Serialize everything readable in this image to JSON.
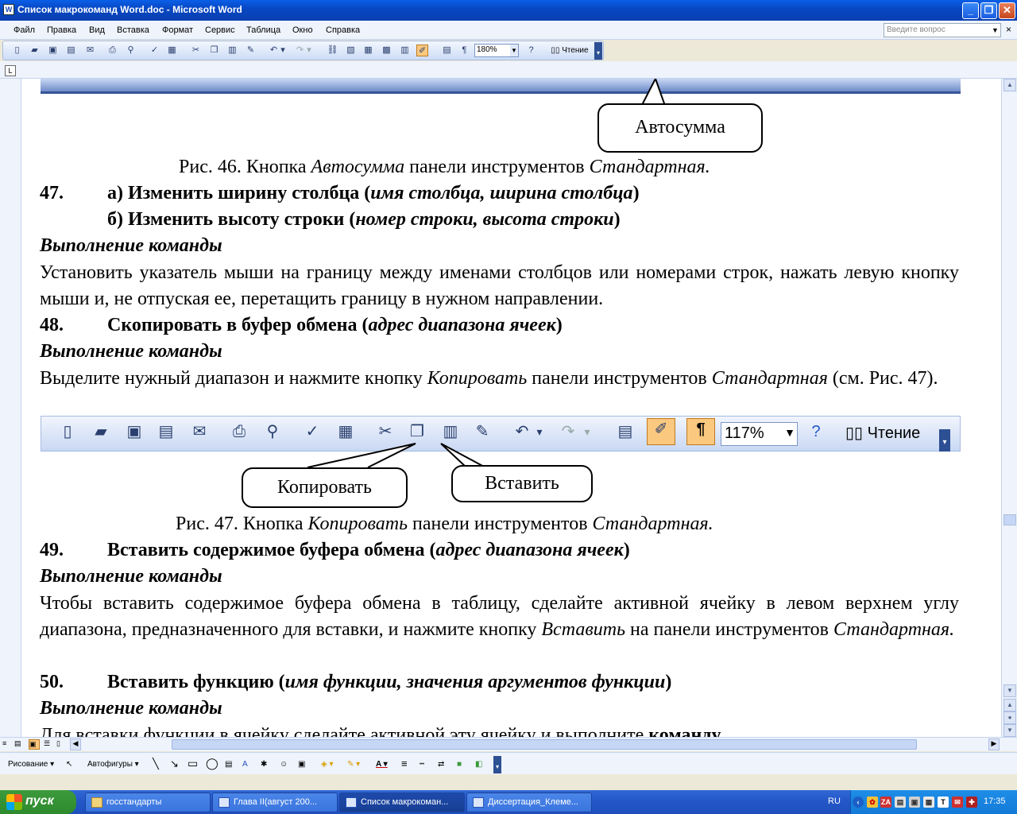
{
  "window": {
    "title": "Список макрокоманд Word.doc - Microsoft Word"
  },
  "menu": {
    "items": [
      "Файл",
      "Правка",
      "Вид",
      "Вставка",
      "Формат",
      "Сервис",
      "Таблица",
      "Окно",
      "Справка"
    ],
    "ask_placeholder": "Введите вопрос"
  },
  "toolbar": {
    "zoom": "180%",
    "reading_label": "Чтение",
    "pilcrow": "¶"
  },
  "doc": {
    "bubble_autosum": "Автосумма",
    "cap46_a": "Рис. 46. Кнопка ",
    "cap46_b": "Автосумма",
    "cap46_c": " панели инструментов ",
    "cap46_d": "Стандартная.",
    "n47": "47.",
    "h47a_1": "а) Изменить ширину столбца (",
    "h47a_2": "имя столбца, ширина столбца",
    "h47a_3": ")",
    "h47b_1": "б) Изменить высоту строки (",
    "h47b_2": "номер строки, высота строки",
    "h47b_3": ")",
    "exec": "Выполнение команды",
    "p47": "Установить указатель мыши на границу между именами столбцов или номерами строк, нажать левую кнопку мыши и, не отпуская ее, перетащить границу в нужном направлении.",
    "n48": "48.",
    "h48_1": "Скопировать в буфер обмена (",
    "h48_2": "адрес диапазона ячеек",
    "h48_3": ")",
    "p48_1": "Выделите нужный диапазон и нажмите кнопку ",
    "p48_2": "Копировать",
    "p48_3": " панели инструментов ",
    "p48_4": "Стандартная",
    "p48_5": " (см. Рис. 47).",
    "fig_zoom": "117%",
    "fig_reading": "Чтение",
    "fig_pilcrow": "¶",
    "bubble_copy": "Копировать",
    "bubble_paste": "Вставить",
    "cap47_a": "Рис. 47. Кнопка ",
    "cap47_b": "Копировать",
    "cap47_c": " панели инструментов ",
    "cap47_d": "Стандартная.",
    "n49": "49.",
    "h49_1": "Вставить содержимое буфера обмена (",
    "h49_2": "адрес диапазона ячеек",
    "h49_3": ")",
    "p49_1": "Чтобы вставить содержимое буфера обмена в таблицу, сделайте активной ячейку в левом верхнем углу диапазона, предназначенного для вставки, и нажмите кнопку ",
    "p49_2": "Вставить",
    "p49_3": " на панели инструментов ",
    "p49_4": "Стандартная.",
    "n50": "50.",
    "h50_1": "Вставить функцию (",
    "h50_2": "имя функции, значения аргументов функции",
    "h50_3": ")",
    "p50_1": "Для вставки функции в ячейку сделайте активной эту ячейку и выполните ",
    "p50_2": "команду"
  },
  "drawbar": {
    "drawing": "Рисование",
    "autoshapes": "Автофигуры"
  },
  "taskbar": {
    "start": "пуск",
    "tasks": [
      "госстандарты",
      "Глава II(август 200...",
      "Список макрокоман...",
      "Диссертация_Клеме..."
    ],
    "lang": "RU",
    "time": "17:35"
  }
}
